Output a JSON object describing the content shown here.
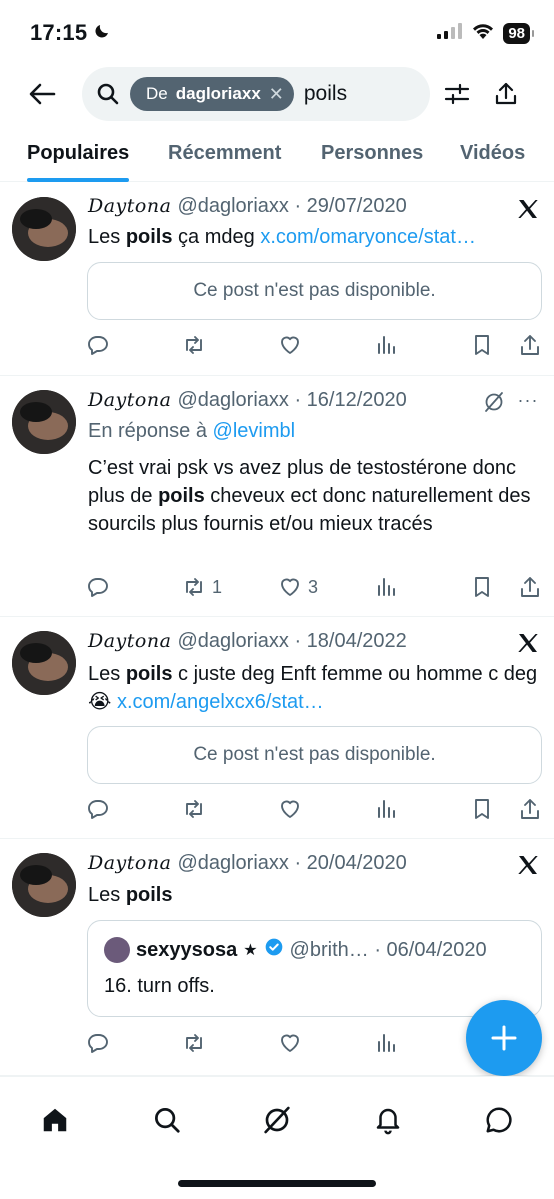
{
  "status_bar": {
    "time": "17:15",
    "battery": "98"
  },
  "search": {
    "chip_prefix": "De",
    "chip_user": "dagloriaxx",
    "chip_close": "✕",
    "query": "poils"
  },
  "tabs": [
    {
      "label": "Populaires"
    },
    {
      "label": "Récemment"
    },
    {
      "label": "Personnes"
    },
    {
      "label": "Vidéos"
    }
  ],
  "posts": [
    {
      "name": "Daytona",
      "meta": "@dagloriaxx · 29/07/2020",
      "text_pre": "Les ",
      "text_bold": "poils",
      "text_post": " ça mdeg ",
      "link": "x.com/omaryonce/stat…",
      "unavailable": "Ce post n'est pas disponible.",
      "corner_icon": "x-logo-icon"
    },
    {
      "name": "Daytona",
      "meta": "@dagloriaxx · 16/12/2020",
      "reply_prefix": "En réponse à ",
      "reply_user": "@levimbl",
      "text_pre": "C’est vrai psk vs avez plus de testostérone donc plus de ",
      "text_bold": "poils",
      "text_post": " cheveux ect donc naturellement des sourcils plus fournis et/ou mieux tracés",
      "retweets": "1",
      "likes": "3",
      "corner_icon": "grok-icon",
      "more": "···"
    },
    {
      "name": "Daytona",
      "meta": "@dagloriaxx · 18/04/2022",
      "text_pre": "Les ",
      "text_bold": "poils",
      "text_post": " c juste deg Enft femme ou homme c deg 😭 ",
      "link": "x.com/angelxcx6/stat…",
      "unavailable": "Ce post n'est pas disponible.",
      "corner_icon": "x-logo-icon"
    },
    {
      "name": "Daytona",
      "meta": "@dagloriaxx · 20/04/2020",
      "text_pre": "Les ",
      "text_bold": "poils",
      "text_post": "",
      "quote": {
        "name": "sexyysosa",
        "star": "★",
        "handle": "@brith… · 06/04/2020",
        "text": "16. turn offs."
      },
      "corner_icon": "x-logo-icon"
    }
  ],
  "fab": {
    "label": "+"
  },
  "colors": {
    "accent": "#1d9bf0",
    "muted": "#536471",
    "text": "#0f1419"
  }
}
